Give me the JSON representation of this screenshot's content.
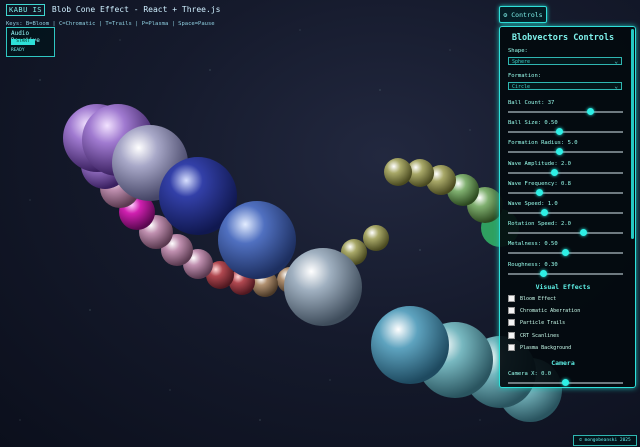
{
  "hud": {
    "logo": "KABU IS",
    "title": "Blob Cone Effect - React + Three.js",
    "keys": "Keys: B=Bloom | C=Chromatic | T=Trails | P=Plasma | Space=Pause",
    "audio_title": "Audio Reactive",
    "audio_button": "START",
    "audio_status": "READY"
  },
  "controls_button": "⚙ Controls",
  "panel": {
    "title": "Blobvectors Controls",
    "shape_label": "Shape:",
    "shape_value": "Sphere",
    "formation_label": "Formation:",
    "formation_value": "Circle",
    "sliders": [
      {
        "label": "Ball Count: 37",
        "fraction": 0.72
      },
      {
        "label": "Ball Size: 0.50",
        "fraction": 0.45
      },
      {
        "label": "Formation Radius: 5.0",
        "fraction": 0.45
      },
      {
        "label": "Wave Amplitude: 2.0",
        "fraction": 0.4
      },
      {
        "label": "Wave Frequency: 0.8",
        "fraction": 0.27
      },
      {
        "label": "Wave Speed: 1.0",
        "fraction": 0.32
      },
      {
        "label": "Rotation Speed: 2.0",
        "fraction": 0.66
      },
      {
        "label": "Metalness: 0.50",
        "fraction": 0.5
      },
      {
        "label": "Roughness: 0.30",
        "fraction": 0.31
      }
    ],
    "visual_title": "Visual Effects",
    "effects": [
      "Bloom Effect",
      "Chromatic Aberration",
      "Particle Trails",
      "CRT Scanlines",
      "Plasma Background"
    ],
    "camera_title": "Camera",
    "camera_slider": {
      "label": "Camera X: 0.0",
      "fraction": 0.5
    }
  },
  "footer": "© mongobeanski 2025",
  "colors": {
    "accent": "#2ef0e6",
    "panel_bg": "#030a0e"
  }
}
